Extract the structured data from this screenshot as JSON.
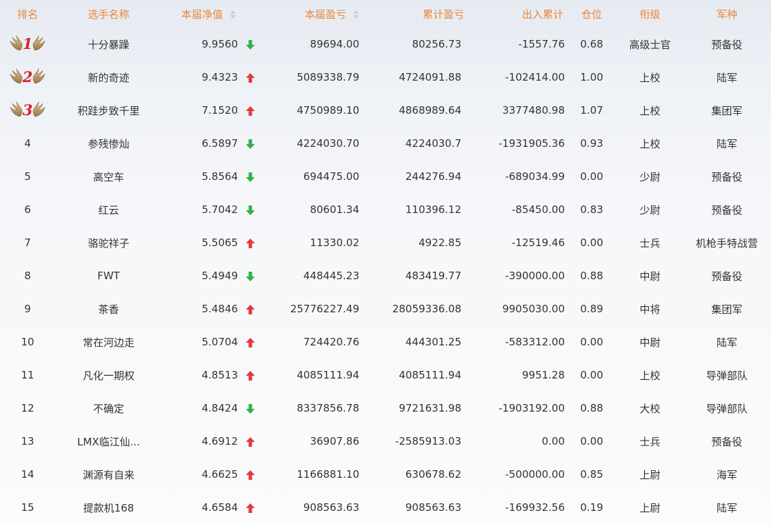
{
  "headers": {
    "rank": "排名",
    "name": "选手名称",
    "nav": "本届净值",
    "profit": "本届盈亏",
    "cumulative": "累计盈亏",
    "flow": "出入累计",
    "position": "仓位",
    "grade": "衔级",
    "branch": "军种"
  },
  "colors": {
    "header": "#e9873a",
    "up": "#e03a3a",
    "down": "#33b14a",
    "rank_top": "#d8232a"
  },
  "rows": [
    {
      "rank": "1",
      "name": "十分暴躁",
      "nav": "9.9560",
      "trend": "down",
      "profit": "89694.00",
      "cumulative": "80256.73",
      "flow": "-1557.76",
      "position": "0.68",
      "grade": "高级士官",
      "branch": "预备役"
    },
    {
      "rank": "2",
      "name": "新的奇迹",
      "nav": "9.4323",
      "trend": "up",
      "profit": "5089338.79",
      "cumulative": "4724091.88",
      "flow": "-102414.00",
      "position": "1.00",
      "grade": "上校",
      "branch": "陆军"
    },
    {
      "rank": "3",
      "name": "积跬步致千里",
      "nav": "7.1520",
      "trend": "up",
      "profit": "4750989.10",
      "cumulative": "4868989.64",
      "flow": "3377480.98",
      "position": "1.07",
      "grade": "上校",
      "branch": "集团军"
    },
    {
      "rank": "4",
      "name": "参残惨灿",
      "nav": "6.5897",
      "trend": "down",
      "profit": "4224030.70",
      "cumulative": "4224030.7",
      "flow": "-1931905.36",
      "position": "0.93",
      "grade": "上校",
      "branch": "陆军"
    },
    {
      "rank": "5",
      "name": "高空车",
      "nav": "5.8564",
      "trend": "down",
      "profit": "694475.00",
      "cumulative": "244276.94",
      "flow": "-689034.99",
      "position": "0.00",
      "grade": "少尉",
      "branch": "预备役"
    },
    {
      "rank": "6",
      "name": "红云",
      "nav": "5.7042",
      "trend": "down",
      "profit": "80601.34",
      "cumulative": "110396.12",
      "flow": "-85450.00",
      "position": "0.83",
      "grade": "少尉",
      "branch": "预备役"
    },
    {
      "rank": "7",
      "name": "骆驼祥子",
      "nav": "5.5065",
      "trend": "up",
      "profit": "11330.02",
      "cumulative": "4922.85",
      "flow": "-12519.46",
      "position": "0.00",
      "grade": "士兵",
      "branch": "机枪手特战营"
    },
    {
      "rank": "8",
      "name": "FWT",
      "nav": "5.4949",
      "trend": "down",
      "profit": "448445.23",
      "cumulative": "483419.77",
      "flow": "-390000.00",
      "position": "0.88",
      "grade": "中尉",
      "branch": "预备役"
    },
    {
      "rank": "9",
      "name": "茶香",
      "nav": "5.4846",
      "trend": "up",
      "profit": "25776227.49",
      "cumulative": "28059336.08",
      "flow": "9905030.00",
      "position": "0.89",
      "grade": "中将",
      "branch": "集团军"
    },
    {
      "rank": "10",
      "name": "常在河边走",
      "nav": "5.0704",
      "trend": "up",
      "profit": "724420.76",
      "cumulative": "444301.25",
      "flow": "-583312.00",
      "position": "0.00",
      "grade": "中尉",
      "branch": "陆军"
    },
    {
      "rank": "11",
      "name": "凡化一期权",
      "nav": "4.8513",
      "trend": "up",
      "profit": "4085111.94",
      "cumulative": "4085111.94",
      "flow": "9951.28",
      "position": "0.00",
      "grade": "上校",
      "branch": "导弹部队"
    },
    {
      "rank": "12",
      "name": "不确定",
      "nav": "4.8424",
      "trend": "down",
      "profit": "8337856.78",
      "cumulative": "9721631.98",
      "flow": "-1903192.00",
      "position": "0.88",
      "grade": "大校",
      "branch": "导弹部队"
    },
    {
      "rank": "13",
      "name": "LMX临江仙...",
      "nav": "4.6912",
      "trend": "up",
      "profit": "36907.86",
      "cumulative": "-2585913.03",
      "flow": "0.00",
      "position": "0.00",
      "grade": "士兵",
      "branch": "预备役"
    },
    {
      "rank": "14",
      "name": "渊源有自来",
      "nav": "4.6625",
      "trend": "up",
      "profit": "1166881.10",
      "cumulative": "630678.62",
      "flow": "-500000.00",
      "position": "0.85",
      "grade": "上尉",
      "branch": "海军"
    },
    {
      "rank": "15",
      "name": "提款机168",
      "nav": "4.6584",
      "trend": "up",
      "profit": "908563.63",
      "cumulative": "908563.63",
      "flow": "-169932.56",
      "position": "0.19",
      "grade": "上尉",
      "branch": "陆军"
    }
  ]
}
